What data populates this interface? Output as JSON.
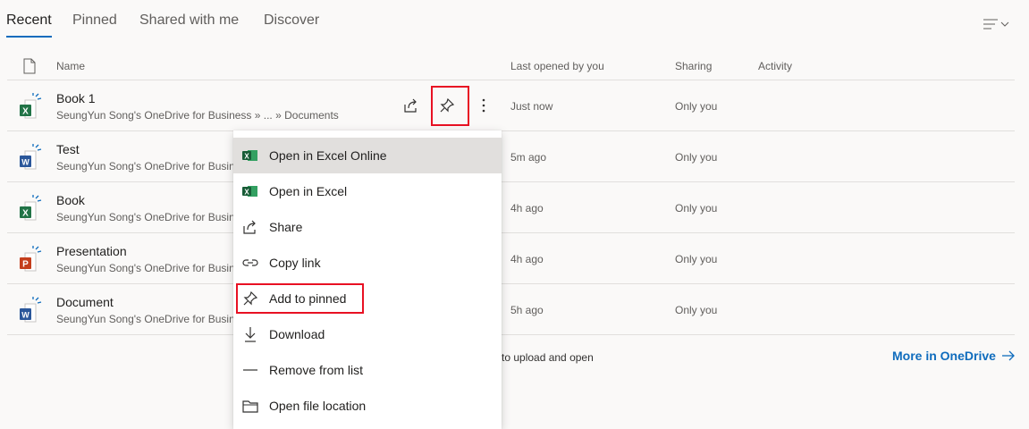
{
  "tabs": [
    {
      "label": "Recent",
      "active": true
    },
    {
      "label": "Pinned",
      "active": false
    },
    {
      "label": "Shared with me",
      "active": false
    },
    {
      "label": "Discover",
      "active": false
    }
  ],
  "view_toggle": {
    "icon": "list-view-icon"
  },
  "columns": {
    "name": "Name",
    "last_opened": "Last opened by you",
    "sharing": "Sharing",
    "activity": "Activity"
  },
  "files": [
    {
      "name": "Book 1",
      "path": "SeungYun Song's OneDrive for Business » ... » Documents",
      "last_opened": "Just now",
      "sharing": "Only you",
      "type": "excel"
    },
    {
      "name": "Test",
      "path": "SeungYun Song's OneDrive for Busin",
      "last_opened": "5m ago",
      "sharing": "Only you",
      "type": "word"
    },
    {
      "name": "Book",
      "path": "SeungYun Song's OneDrive for Busin",
      "last_opened": "4h ago",
      "sharing": "Only you",
      "type": "excel"
    },
    {
      "name": "Presentation",
      "path": "SeungYun Song's OneDrive for Busin",
      "last_opened": "4h ago",
      "sharing": "Only you",
      "type": "powerpoint"
    },
    {
      "name": "Document",
      "path": "SeungYun Song's OneDrive for Busin",
      "last_opened": "5h ago",
      "sharing": "Only you",
      "type": "word"
    }
  ],
  "context_menu": {
    "items": [
      {
        "label": "Open in Excel Online",
        "icon": "excel-icon"
      },
      {
        "label": "Open in Excel",
        "icon": "excel-icon"
      },
      {
        "label": "Share",
        "icon": "share-icon"
      },
      {
        "label": "Copy link",
        "icon": "link-icon"
      },
      {
        "label": "Add to pinned",
        "icon": "pin-icon"
      },
      {
        "label": "Download",
        "icon": "download-icon"
      },
      {
        "label": "Remove from list",
        "icon": "remove-icon"
      },
      {
        "label": "Open file location",
        "icon": "folder-icon"
      }
    ]
  },
  "footer": {
    "upload_text": "to upload and open",
    "more_link": "More in OneDrive"
  },
  "colors": {
    "accent": "#0f6cbd",
    "excel": "#217346",
    "word": "#2b579a",
    "powerpoint": "#c43e1c",
    "highlight": "#e81123"
  }
}
